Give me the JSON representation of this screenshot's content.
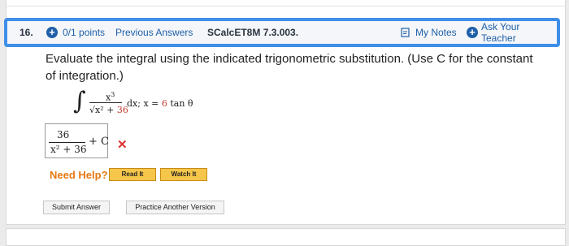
{
  "header": {
    "number": "16.",
    "points": "0/1 points",
    "previous_answers": "Previous Answers",
    "reference": "SCalcET8M 7.3.003.",
    "my_notes": "My Notes",
    "ask_teacher": "Ask Your Teacher"
  },
  "question": {
    "text": "Evaluate the integral using the indicated trigonometric substitution. (Use C for the constant of integration.)",
    "numerator": "x3",
    "denominator_prefix": "√x² + ",
    "denominator_value": "36",
    "dx_text": "dx;  x = ",
    "sub_value": "6",
    "sub_func": " tan θ"
  },
  "answer": {
    "numerator": "36",
    "denominator": "x² + 36",
    "plus_c": "+ C",
    "status_mark": "✕"
  },
  "help": {
    "label": "Need Help?",
    "read_it": "Read It",
    "watch_it": "Watch It"
  },
  "actions": {
    "submit": "Submit Answer",
    "practice": "Practice Another Version"
  }
}
